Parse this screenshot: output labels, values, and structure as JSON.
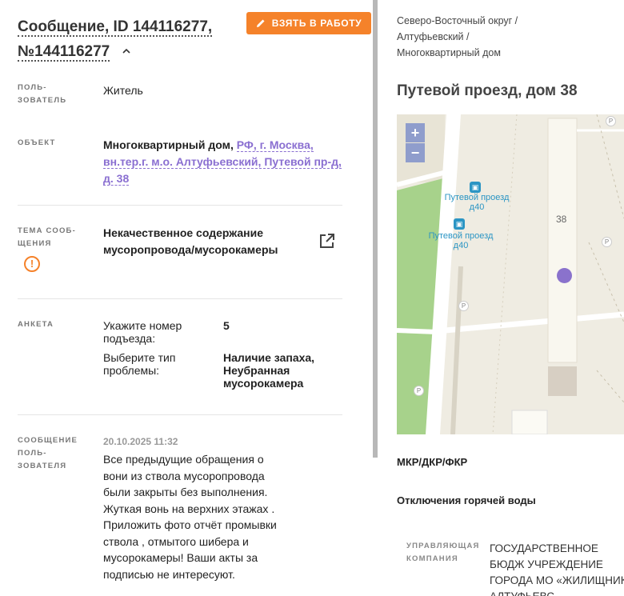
{
  "message": {
    "title": "Сообщение, ID 144116277, №144116277",
    "take_button": "ВЗЯТЬ В РАБОТУ",
    "user_label": "ПОЛЬ-\nЗОВАТЕЛЬ",
    "user_value": "Житель",
    "object_label": "ОБЪЕКТ",
    "object_type": "Многоквартирный дом,",
    "object_address": "РФ, г. Москва, вн.тер.г. м.о. Алтуфьевский, Путевой пр-д, д. 38",
    "topic_label": "ТЕМА СООБ-\nЩЕНИЯ",
    "topic_value": "Некачественное содержание мусоропровода/мусорокамеры",
    "form_label": "АНКЕТА",
    "form_q1": "Укажите номер подъезда:",
    "form_a1": "5",
    "form_q2": "Выберите тип проблемы:",
    "form_a2": "Наличие запаха, Неубранная мусорокамера",
    "user_msg_label": "СООБЩЕНИЕ ПОЛЬ-\nЗОВАТЕЛЯ",
    "date": "20.10.2025 11:32",
    "text": "Все предыдущие обращения о вони из ствола мусоропровода были закрыты без выполнения. Жуткая вонь на верхних этажах . Приложить фото отчёт промывки ствола , отмытого шибера и мусорокамеры! Ваши акты за подписью не интересуют."
  },
  "location": {
    "crumbs": [
      "Северо-Восточный округ /",
      "Алтуфьевский /",
      "Многоквартирный дом"
    ],
    "address": "Путевой проезд, дом 38",
    "map": {
      "zoom_in": "+",
      "zoom_out": "−",
      "stop_name": "Путевой проезд д40",
      "building_number": "38",
      "parking": "P"
    },
    "section1": "МКР/ДКР/ФКР",
    "section2": "Отключения горячей воды",
    "uk_label": "УПРАВЛЯЮЩАЯ КОМПАНИЯ",
    "uk_value": "ГОСУДАРСТВЕННОЕ БЮДЖ УЧРЕЖДЕНИЕ ГОРОДА МО «ЖИЛИЩНИК АЛТУФЬЕВС"
  },
  "colors": {
    "accent": "#f5822a",
    "link": "#8a6fd1",
    "map_marker": "#8a72cc"
  }
}
